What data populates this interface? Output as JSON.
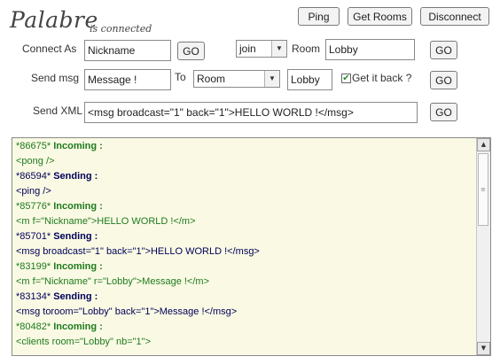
{
  "header": {
    "logo": "Palabre",
    "status": "is connected",
    "ping_label": "Ping",
    "get_rooms_label": "Get Rooms",
    "disconnect_label": "Disconnect"
  },
  "connect": {
    "label": "Connect As",
    "nickname_value": "Nickname",
    "go_label": "GO",
    "action_value": "join",
    "room_label": "Room",
    "room_value": "Lobby",
    "go2_label": "GO"
  },
  "send_msg": {
    "label": "Send msg",
    "message_value": "Message !",
    "to_label": "To",
    "target_type_value": "Room",
    "target_value": "Lobby",
    "get_it_back_label": "Get it back ?",
    "get_it_back_checked": true,
    "go_label": "GO"
  },
  "send_xml": {
    "label": "Send XML",
    "xml_value": "<msg broadcast=\"1\" back=\"1\">HELLO WORLD !</msg>",
    "go_label": "GO"
  },
  "log": [
    {
      "type": "incoming",
      "id": "*86675*",
      "tag": "Incoming :",
      "text": "<pong />"
    },
    {
      "type": "sending",
      "id": "*86594*",
      "tag": "Sending :",
      "text": "<ping />"
    },
    {
      "type": "incoming",
      "id": "*85776*",
      "tag": "Incoming :",
      "text": "<m f=\"Nickname\">HELLO WORLD !</m>"
    },
    {
      "type": "sending",
      "id": "*85701*",
      "tag": "Sending :",
      "text": "<msg broadcast=\"1\" back=\"1\">HELLO WORLD !</msg>"
    },
    {
      "type": "incoming",
      "id": "*83199*",
      "tag": "Incoming :",
      "text": "<m f=\"Nickname\" r=\"Lobby\">Message !</m>"
    },
    {
      "type": "sending",
      "id": "*83134*",
      "tag": "Sending :",
      "text": "<msg toroom=\"Lobby\"  back=\"1\">Message !</msg>"
    },
    {
      "type": "incoming",
      "id": "*80482*",
      "tag": "Incoming :",
      "text": "<clients room=\"Lobby\" nb=\"1\">"
    }
  ],
  "icons": {
    "scroll_up": "scroll-up-arrow-icon",
    "scroll_down": "scroll-down-arrow-icon",
    "dropdown": "chevron-down-icon",
    "check": "checkmark-icon"
  },
  "colors": {
    "incoming": "#1e7a1e",
    "sending": "#00005a",
    "log_background": "#fafae4"
  }
}
